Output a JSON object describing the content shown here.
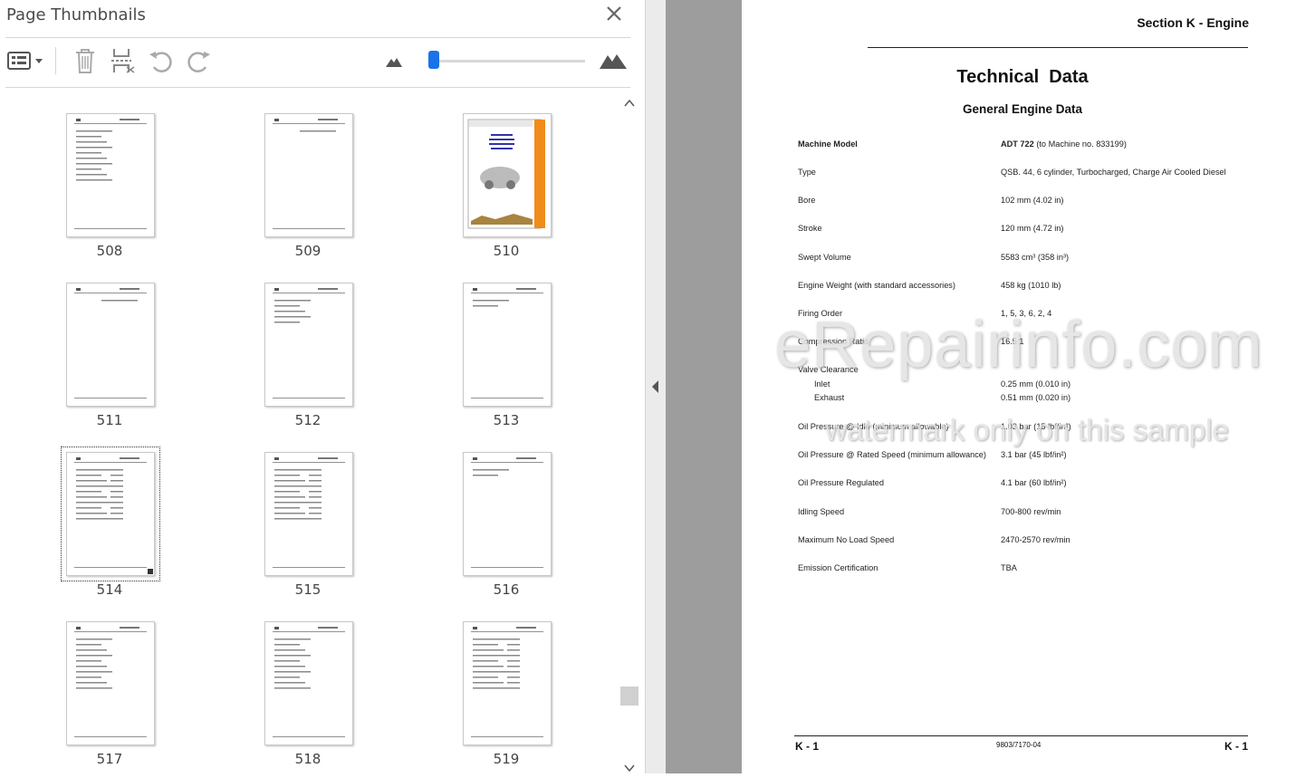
{
  "panel": {
    "title": "Page Thumbnails",
    "toolbar": {
      "options_icon": "thumbnail-options-icon",
      "delete_icon": "trash-icon",
      "extract_icon": "extract-pages-icon",
      "rotate_ccw_icon": "rotate-ccw-icon",
      "rotate_cw_icon": "rotate-cw-icon",
      "zoom_out_icon": "small-mountain-icon",
      "zoom_in_icon": "large-mountain-icon",
      "zoom_level": 0.02
    },
    "thumbnails": [
      {
        "label": "508"
      },
      {
        "label": "509"
      },
      {
        "label": "510"
      },
      {
        "label": "511"
      },
      {
        "label": "512"
      },
      {
        "label": "513"
      },
      {
        "label": "514",
        "selected": true
      },
      {
        "label": "515"
      },
      {
        "label": "516"
      },
      {
        "label": "517"
      },
      {
        "label": "518"
      },
      {
        "label": "519"
      }
    ]
  },
  "document": {
    "section_heading": "Section K - Engine",
    "title": "Technical  Data",
    "subtitle": "General Engine Data",
    "rows": [
      {
        "label": "Machine Model",
        "value": "ADT 722",
        "value_suffix": " (to Machine no. 833199)",
        "bold": true
      },
      {
        "label": "Type",
        "value": "QSB. 44, 6 cylinder, Turbocharged, Charge Air Cooled Diesel"
      },
      {
        "label": "Bore",
        "value": "102 mm (4.02 in)"
      },
      {
        "label": "Stroke",
        "value": "120 mm (4.72 in)"
      },
      {
        "label": "Swept Volume",
        "value": "5583 cm³ (358 in³)"
      },
      {
        "label": "Engine Weight (with standard accessories)",
        "value": "458 kg (1010 lb)"
      },
      {
        "label": "Firing Order",
        "value": "1, 5, 3, 6, 2, 4"
      },
      {
        "label": "Compression Ratio",
        "value": "16.5:1"
      },
      {
        "label": "Valve Clearance",
        "value": ""
      },
      {
        "label": "Inlet",
        "value": "0.25 mm (0.010 in)",
        "indent": true
      },
      {
        "label": "Exhaust",
        "value": "0.51 mm (0.020 in)",
        "indent": true
      },
      {
        "label": "Oil Pressure @ Idle (minimum allowable)",
        "value": "1.03 bar (15 lbf/in²)"
      },
      {
        "label": "Oil Pressure @ Rated Speed (minimum allowance)",
        "value": "3.1 bar (45 lbf/in²)"
      },
      {
        "label": "Oil Pressure Regulated",
        "value": "4.1 bar (60 lbf/in²)"
      },
      {
        "label": "Idling Speed",
        "value": "700-800 rev/min"
      },
      {
        "label": "Maximum No Load Speed",
        "value": "2470-2570 rev/min"
      },
      {
        "label": "Emission Certification",
        "value": "TBA"
      }
    ],
    "watermark_line1": "eRepairinfo.com",
    "watermark_line2": "watermark only on this sample",
    "footer_left": "K - 1",
    "footer_center": "9803/7170-04",
    "footer_right": "K - 1"
  }
}
